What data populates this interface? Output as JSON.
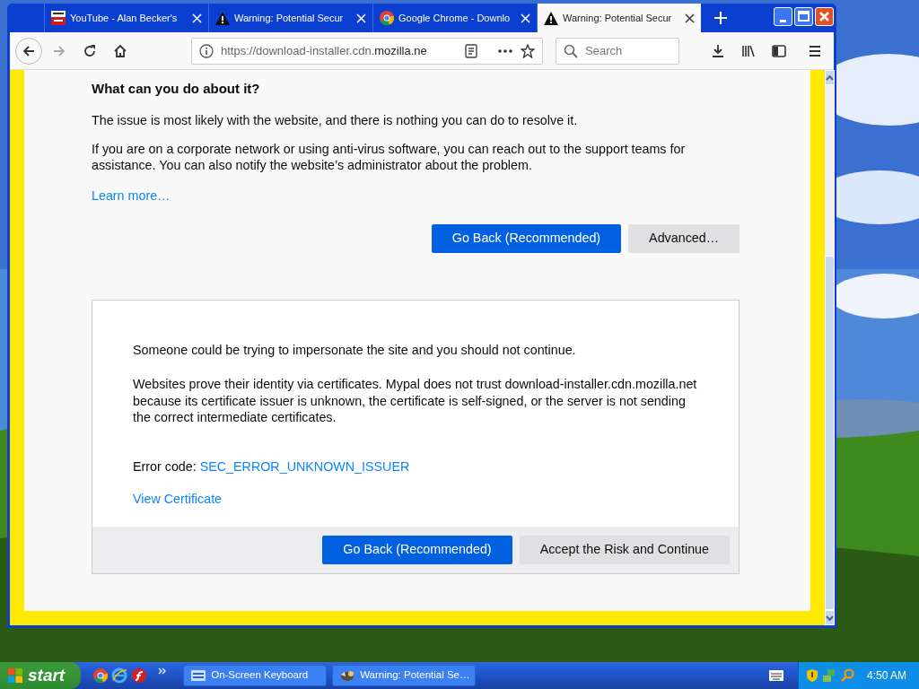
{
  "tabs": [
    {
      "label": "YouTube - Alan Becker's",
      "kind": "video",
      "selected": false
    },
    {
      "label": "Warning: Potential Secur",
      "kind": "warning",
      "selected": false
    },
    {
      "label": "Google Chrome - Downlo",
      "kind": "chrome",
      "selected": false
    },
    {
      "label": "Warning: Potential Secur",
      "kind": "warning",
      "selected": true
    }
  ],
  "toolbar": {
    "url_prefix": "https://download-installer.cdn.",
    "url_domain": "mozilla.ne",
    "search_placeholder": "Search"
  },
  "content": {
    "heading": "What can you do about it?",
    "paragraphs": [
      "The issue is most likely with the website, and there is nothing you can do to resolve it.",
      "If you are on a corporate network or using anti-virus software, you can reach out to the support teams for assistance. You can also notify the website’s administrator about the problem."
    ],
    "learn_more": "Learn more…",
    "buttons": [
      {
        "label": "Go Back (Recommended)",
        "kind": "primary"
      },
      {
        "label": "Advanced…",
        "kind": "secondary"
      }
    ],
    "advanced": {
      "intro": "Someone could be trying to impersonate the site and you should not continue.",
      "detail": "Websites prove their identity via certificates. Mypal does not trust download-installer.cdn.mozilla.net because its certificate issuer is unknown, the certificate is self-signed, or the server is not sending the correct intermediate certificates.",
      "error_label": "Error code:",
      "error_code": "SEC_ERROR_UNKNOWN_ISSUER",
      "view_certificate": "View Certificate",
      "buttons": [
        {
          "label": "Go Back (Recommended)",
          "kind": "primary"
        },
        {
          "label": "Accept the Risk and Continue",
          "kind": "secondary"
        }
      ]
    }
  },
  "taskbar": {
    "start": "start",
    "tasks": [
      {
        "label": "On-Screen Keyboard",
        "kind": "keyboard"
      },
      {
        "label": "Warning: Potential Se…",
        "kind": "browser"
      }
    ],
    "clock": "4:50 AM"
  }
}
